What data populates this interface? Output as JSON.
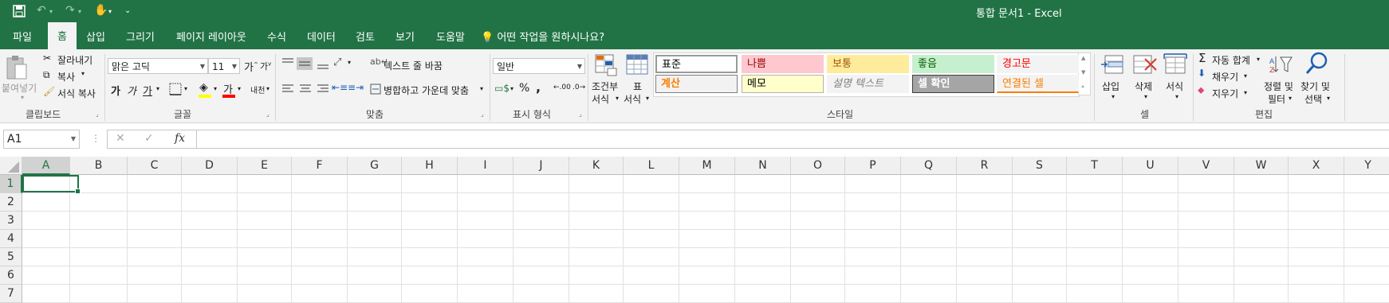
{
  "title_bar": {
    "document_title": "통합 문서1  -  Excel",
    "quick_access": [
      "save-icon",
      "undo-icon",
      "redo-icon",
      "touch-mode-icon",
      "customize-icon"
    ]
  },
  "tabs": [
    "파일",
    "홈",
    "삽입",
    "그리기",
    "페이지 레이아웃",
    "수식",
    "데이터",
    "검토",
    "보기",
    "도움말"
  ],
  "active_tab": "홈",
  "tell_me": "어떤 작업을 원하시나요?",
  "ribbon": {
    "clipboard": {
      "paste": "붙여넣기",
      "cut": "잘라내기",
      "copy": "복사",
      "format_painter": "서식 복사",
      "label": "클립보드"
    },
    "font": {
      "font_name": "맑은 고딕",
      "font_size": "11",
      "grow": "가",
      "shrink": "가",
      "bold": "가",
      "italic": "가",
      "underline": "가",
      "font_color_glyph": "가",
      "phonetic": "내천",
      "label": "글꼴"
    },
    "alignment": {
      "wrap_text": "텍스트 줄 바꿈",
      "merge_center": "병합하고 가운데 맞춤",
      "label": "맞춤"
    },
    "number": {
      "format": "일반",
      "percent": "%",
      "comma": ",",
      "inc_decimal": ".00",
      "dec_decimal": ".0",
      "label": "표시 형식"
    },
    "styles": {
      "conditional_format": [
        "조건부",
        "서식"
      ],
      "format_as_table": [
        "표",
        "서식"
      ],
      "cells": [
        {
          "label": "표준",
          "bg": "#ffffff",
          "color": "#000000",
          "border": "#9a9a9a"
        },
        {
          "label": "나쁨",
          "bg": "#ffc7ce",
          "color": "#9c0006",
          "border": "#ffc7ce"
        },
        {
          "label": "보통",
          "bg": "#ffeb9c",
          "color": "#9c5700",
          "border": "#ffeb9c"
        },
        {
          "label": "좋음",
          "bg": "#c6efce",
          "color": "#006100",
          "border": "#c6efce"
        },
        {
          "label": "경고문",
          "bg": "#f3f3f3",
          "color": "#ff0000",
          "border": "#f3f3f3"
        },
        {
          "label": "계산",
          "bg": "#f2f2f2",
          "color": "#fa7d00",
          "border": "#7f7f7f"
        },
        {
          "label": "메모",
          "bg": "#ffffcc",
          "color": "#000000",
          "border": "#b2b2b2"
        },
        {
          "label": "설명 텍스트",
          "bg": "#f3f3f3",
          "color": "#7f7f7f",
          "border": "#f3f3f3"
        },
        {
          "label": "셀 확인",
          "bg": "#a5a5a5",
          "color": "#ffffff",
          "border": "#3f3f3f"
        },
        {
          "label": "연결된 셀",
          "bg": "#f3f3f3",
          "color": "#fa7d00",
          "border": "#f3f3f3"
        }
      ],
      "label": "스타일"
    },
    "cells_group": {
      "insert": "삽입",
      "delete": "삭제",
      "format": "서식",
      "label": "셀"
    },
    "editing": {
      "autosum": "자동 합계",
      "fill": "채우기",
      "clear": "지우기",
      "sort_filter": [
        "정렬 및",
        "필터"
      ],
      "find_select": [
        "찾기 및",
        "선택"
      ],
      "label": "편집"
    }
  },
  "formula_bar": {
    "name_box": "A1",
    "cancel": "✕",
    "enter": "✓",
    "fx": "fx",
    "value": ""
  },
  "grid": {
    "columns": [
      "A",
      "B",
      "C",
      "D",
      "E",
      "F",
      "G",
      "H",
      "I",
      "J",
      "K",
      "L",
      "M",
      "N",
      "O",
      "P",
      "Q",
      "R",
      "S",
      "T",
      "U",
      "V",
      "W",
      "X",
      "Y"
    ],
    "rows": [
      "1",
      "2",
      "3",
      "4",
      "5",
      "6",
      "7"
    ],
    "selected_cell": "A1"
  },
  "colors": {
    "accent": "#217346",
    "ribbon_bg": "#f3f3f3"
  }
}
